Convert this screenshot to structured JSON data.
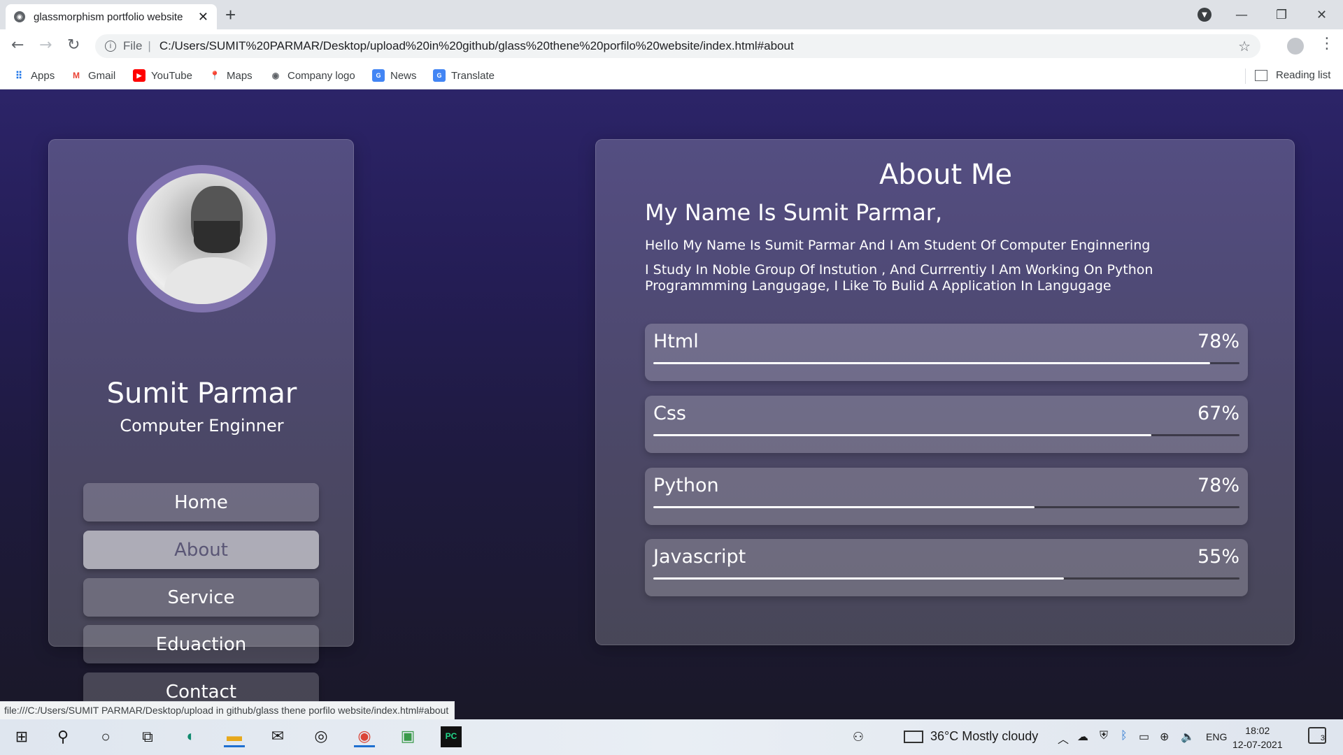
{
  "browser": {
    "tab_title": "glassmorphism portfolio website",
    "url_scheme": "File",
    "url": "C:/Users/SUMIT%20PARMAR/Desktop/upload%20in%20github/glass%20thene%20porfilo%20website/index.html#about",
    "bookmarks": [
      "Apps",
      "Gmail",
      "YouTube",
      "Maps",
      "Company logo",
      "News",
      "Translate"
    ],
    "reading_list": "Reading list",
    "status_link": "file:///C:/Users/SUMIT PARMAR/Desktop/upload in github/glass thene porfilo website/index.html#about"
  },
  "profile": {
    "name": "Sumit Parmar",
    "role": "Computer Enginner",
    "menu": [
      "Home",
      "About",
      "Service",
      "Eduaction",
      "Contact"
    ],
    "active_menu": "About"
  },
  "about": {
    "title": "About Me",
    "subhead": "My Name Is Sumit Parmar,",
    "para1": "Hello My Name Is Sumit Parmar And I Am Student Of Computer Enginnering",
    "para2": "I Study In Noble Group Of Instution , And Currrentiy I Am Working On Python Programmming Langugage, I Like To Bulid A Application In Langugage",
    "skills": [
      {
        "label": "Html",
        "percent_text": "78%",
        "fill_fraction": 0.95
      },
      {
        "label": "Css",
        "percent_text": "67%",
        "fill_fraction": 0.85
      },
      {
        "label": "Python",
        "percent_text": "78%",
        "fill_fraction": 0.65
      },
      {
        "label": "Javascript",
        "percent_text": "55%",
        "fill_fraction": 0.7
      }
    ]
  },
  "taskbar": {
    "weather": "36°C  Mostly cloudy",
    "language": "ENG",
    "time": "18:02",
    "date": "12-07-2021",
    "notifications": "3"
  }
}
